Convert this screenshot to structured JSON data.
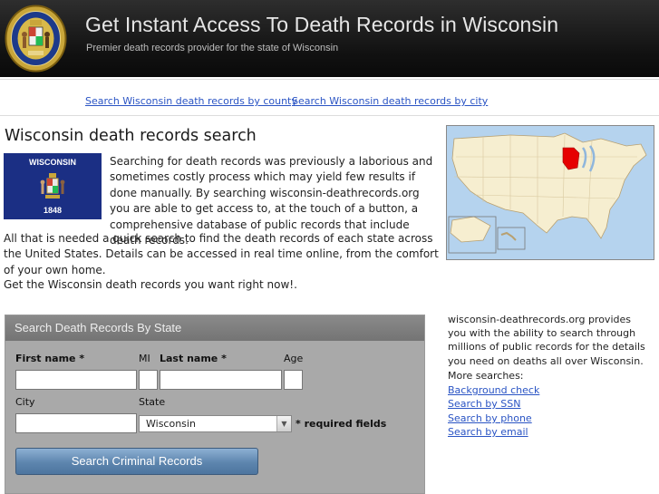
{
  "header": {
    "title": "Get Instant Access To Death Records in Wisconsin",
    "subtitle": "Premier death records provider for the state of Wisconsin"
  },
  "nav_links": [
    "Search Wisconsin death records by county",
    "Search Wisconsin death records by city"
  ],
  "main": {
    "heading": "Wisconsin death records search",
    "flag": {
      "top": "WISCONSIN",
      "bottom": "1848"
    },
    "paragraph1": "Searching for death records was previously a laborious and sometimes costly process which may yield few results if done manually. By searching wisconsin-deathrecords.org you are able to get access to, at the touch of a button, a comprehensive database of public records that include death records.",
    "paragraph2": "All that is needed a quick search to find the death records of each state across the United States. Details can be accessed in real time online, from the comfort of your own home.",
    "paragraph3": "Get the Wisconsin death records you want right now!."
  },
  "form": {
    "title": "Search Death Records By State",
    "first_name_label": "First name *",
    "mi_label": "MI",
    "last_name_label": "Last name *",
    "age_label": "Age",
    "city_label": "City",
    "state_label": "State",
    "state_value": "Wisconsin",
    "required_note": "* required fields",
    "submit_label": "Search Criminal Records"
  },
  "sidebar": {
    "description": "wisconsin-deathrecords.org provides you with the ability to search through millions of public records for the details you need on deaths all over Wisconsin.",
    "more_label": "More searches:",
    "links": [
      "Background check",
      "Search by SSN",
      "Search by phone",
      "Search by email"
    ]
  },
  "colors": {
    "header_bg": "#111111",
    "link": "#2a54c4",
    "flag_blue": "#1b2f84",
    "form_bg": "#a9a9a9",
    "button": "#5d85ae",
    "map_highlight": "#e60000"
  }
}
